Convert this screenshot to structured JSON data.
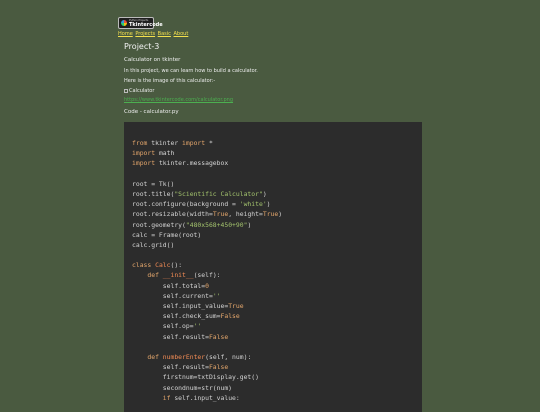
{
  "logo": {
    "small_text": "Python Projects",
    "brand_text": "Tkintercode"
  },
  "nav": {
    "items": [
      "Home",
      "Projects",
      "Basic",
      "About"
    ]
  },
  "page": {
    "title": "Project-3",
    "subtitle": "Calculator on tkinter",
    "intro": "In this project, we can learn how to build a calculator.",
    "image_intro": "Here is the image of this calculator:-",
    "image_alt": "Calculator",
    "image_link": "https://www.tkintercode.com/calculator.png",
    "code_label": "Code - calculator.py"
  },
  "code": {
    "lines": [
      [
        [
          "kw",
          "from"
        ],
        [
          "t",
          " tkinter "
        ],
        [
          "kw",
          "import"
        ],
        [
          "t",
          " *"
        ]
      ],
      [
        [
          "kw",
          "import"
        ],
        [
          "t",
          " math"
        ]
      ],
      [
        [
          "kw",
          "import"
        ],
        [
          "t",
          " tkinter.messagebox"
        ]
      ],
      [],
      [
        [
          "t",
          "root = Tk()"
        ]
      ],
      [
        [
          "t",
          "root.title("
        ],
        [
          "str",
          "\"Scientific Calculator\""
        ],
        [
          "t",
          ")"
        ]
      ],
      [
        [
          "t",
          "root.configure(background = "
        ],
        [
          "str",
          "'white'"
        ],
        [
          "t",
          ")"
        ]
      ],
      [
        [
          "t",
          "root.resizable(width="
        ],
        [
          "kw",
          "True"
        ],
        [
          "t",
          ", height="
        ],
        [
          "kw",
          "True"
        ],
        [
          "t",
          ")"
        ]
      ],
      [
        [
          "t",
          "root.geometry("
        ],
        [
          "str",
          "\"480x568+450+90\""
        ],
        [
          "t",
          ")"
        ]
      ],
      [
        [
          "t",
          "calc = Frame(root)"
        ]
      ],
      [
        [
          "t",
          "calc.grid()"
        ]
      ],
      [],
      [
        [
          "kw",
          "class"
        ],
        [
          "t",
          " "
        ],
        [
          "fn",
          "Calc"
        ],
        [
          "t",
          "():"
        ]
      ],
      [
        [
          "t",
          "    "
        ],
        [
          "kw",
          "def"
        ],
        [
          "t",
          " "
        ],
        [
          "fn",
          "__init__"
        ],
        [
          "t",
          "(self):"
        ]
      ],
      [
        [
          "t",
          "        self.total="
        ],
        [
          "kw",
          "0"
        ]
      ],
      [
        [
          "t",
          "        self.current="
        ],
        [
          "str",
          "''"
        ]
      ],
      [
        [
          "t",
          "        self.input_value="
        ],
        [
          "kw",
          "True"
        ]
      ],
      [
        [
          "t",
          "        self.check_sum="
        ],
        [
          "kw",
          "False"
        ]
      ],
      [
        [
          "t",
          "        self.op="
        ],
        [
          "str",
          "''"
        ]
      ],
      [
        [
          "t",
          "        self.result="
        ],
        [
          "kw",
          "False"
        ]
      ],
      [],
      [
        [
          "t",
          "    "
        ],
        [
          "kw",
          "def"
        ],
        [
          "t",
          " "
        ],
        [
          "fn",
          "numberEnter"
        ],
        [
          "t",
          "(self, num):"
        ]
      ],
      [
        [
          "t",
          "        self.result="
        ],
        [
          "kw",
          "False"
        ]
      ],
      [
        [
          "t",
          "        firstnum=txtDisplay.get()"
        ]
      ],
      [
        [
          "t",
          "        secondnum=str(num)"
        ]
      ],
      [
        [
          "t",
          "        "
        ],
        [
          "kw",
          "if"
        ],
        [
          "t",
          " self.input_value:"
        ]
      ]
    ]
  },
  "colors": {
    "page_bg": "#4a5a40",
    "code_bg": "#2c2c2c",
    "nav_link": "#f4e04d",
    "image_link": "#4caf50",
    "keyword": "#e5a76c",
    "string": "#a3c36d",
    "function": "#f28b54"
  }
}
